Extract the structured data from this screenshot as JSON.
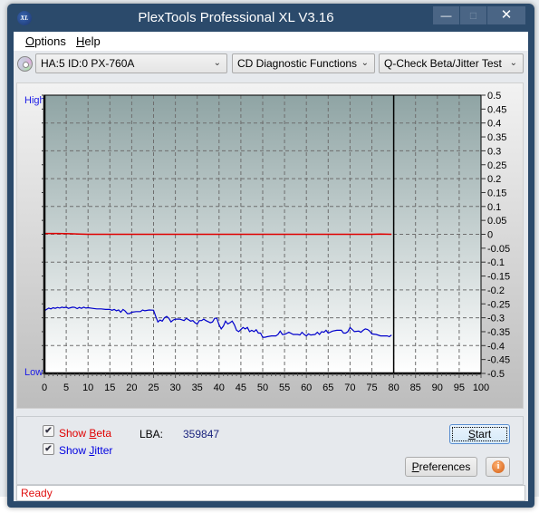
{
  "window": {
    "title": "PlexTools Professional XL V3.16",
    "app_icon": "XL",
    "controls": {
      "minimize": "minimize-icon",
      "maximize": "maximize-icon",
      "close": "close-icon"
    }
  },
  "menu": {
    "items": [
      {
        "label": "Options",
        "accel": "O",
        "rest": "ptions"
      },
      {
        "label": "Help",
        "accel": "H",
        "rest": "elp"
      }
    ]
  },
  "toolbar": {
    "drive_icon": "cd-disc-icon",
    "drive": "HA:5 ID:0  PX-760A",
    "function_group": "CD Diagnostic Functions",
    "test": "Q-Check Beta/Jitter Test"
  },
  "chart_labels": {
    "high": "High",
    "low": "Low"
  },
  "chart_data": {
    "type": "line",
    "title": "",
    "xlabel": "",
    "ylabel": "",
    "xlim": [
      0,
      100
    ],
    "ylim": [
      -0.5,
      0.5
    ],
    "x_ticks": [
      0,
      5,
      10,
      15,
      20,
      25,
      30,
      35,
      40,
      45,
      50,
      55,
      60,
      65,
      70,
      75,
      80,
      85,
      90,
      95,
      100
    ],
    "y_ticks": [
      0.5,
      0.45,
      0.4,
      0.35,
      0.3,
      0.25,
      0.2,
      0.15,
      0.1,
      0.05,
      0,
      -0.05,
      -0.1,
      -0.15,
      -0.2,
      -0.25,
      -0.3,
      -0.35,
      -0.4,
      -0.45,
      -0.5
    ],
    "y_tick_labels": [
      "0.5",
      "0.45",
      "0.4",
      "0.35",
      "0.3",
      "0.25",
      "0.2",
      "0.15",
      "0.1",
      "0.05",
      "0",
      "-0.05",
      "-0.1",
      "-0.15",
      "-0.2",
      "-0.25",
      "-0.3",
      "-0.35",
      "-0.4",
      "-0.45",
      "-0.5"
    ],
    "grid": true,
    "progress_marker_x": 80,
    "series": [
      {
        "name": "Beta",
        "color": "#e00000",
        "x": [
          0,
          3,
          6,
          8,
          10,
          20,
          30,
          40,
          50,
          60,
          70,
          75,
          77,
          79.5
        ],
        "values": [
          0.003,
          0.003,
          0.002,
          0.001,
          0.0,
          0.0,
          0.0,
          0.0,
          0.0,
          0.0,
          0.0,
          0.0,
          0.001,
          0.0
        ]
      },
      {
        "name": "Jitter",
        "color": "#0000cc",
        "x": [
          0,
          0.5,
          1,
          1.5,
          2,
          2.5,
          3,
          3.5,
          4,
          4.5,
          5,
          5.5,
          6,
          6.5,
          7,
          7.5,
          8,
          8.5,
          9,
          9.5,
          10,
          11,
          12,
          13,
          14,
          15,
          15.5,
          16,
          16.5,
          17,
          17.5,
          18,
          18.5,
          19,
          19.5,
          20,
          21,
          22,
          22.5,
          23,
          24,
          25,
          25.5,
          26,
          26.5,
          27,
          27.5,
          28,
          28.5,
          29,
          29.5,
          30,
          31,
          32,
          32.5,
          33,
          33.5,
          34,
          34.5,
          35,
          35.5,
          36,
          36.5,
          37,
          38,
          38.5,
          39,
          39.5,
          40,
          40.5,
          41,
          41.5,
          42,
          42.5,
          43,
          43.5,
          44,
          44.5,
          45,
          45.5,
          46,
          46.5,
          47,
          47.5,
          48,
          48.5,
          49,
          49.5,
          50,
          50.5,
          51,
          52,
          53,
          53.5,
          54,
          54.5,
          55,
          56,
          57,
          58,
          58.5,
          59,
          59.5,
          60,
          60.5,
          61,
          62,
          62.5,
          63,
          63.5,
          64,
          64.5,
          65,
          66,
          67,
          68,
          68.5,
          69,
          69.5,
          70,
          70.5,
          71,
          72,
          72.5,
          73,
          73.5,
          74,
          74.5,
          75,
          76,
          77,
          78,
          78.5,
          79,
          79.5
        ],
        "values": [
          -0.275,
          -0.27,
          -0.265,
          -0.268,
          -0.264,
          -0.266,
          -0.263,
          -0.265,
          -0.262,
          -0.264,
          -0.262,
          -0.266,
          -0.264,
          -0.262,
          -0.263,
          -0.267,
          -0.263,
          -0.266,
          -0.262,
          -0.265,
          -0.264,
          -0.266,
          -0.268,
          -0.268,
          -0.27,
          -0.27,
          -0.273,
          -0.27,
          -0.275,
          -0.272,
          -0.28,
          -0.27,
          -0.276,
          -0.285,
          -0.285,
          -0.28,
          -0.278,
          -0.278,
          -0.272,
          -0.275,
          -0.272,
          -0.273,
          -0.295,
          -0.315,
          -0.308,
          -0.312,
          -0.3,
          -0.295,
          -0.302,
          -0.315,
          -0.308,
          -0.305,
          -0.305,
          -0.31,
          -0.302,
          -0.307,
          -0.312,
          -0.31,
          -0.318,
          -0.322,
          -0.31,
          -0.31,
          -0.305,
          -0.31,
          -0.318,
          -0.315,
          -0.302,
          -0.302,
          -0.325,
          -0.34,
          -0.33,
          -0.312,
          -0.322,
          -0.318,
          -0.312,
          -0.325,
          -0.345,
          -0.35,
          -0.342,
          -0.335,
          -0.34,
          -0.335,
          -0.35,
          -0.345,
          -0.35,
          -0.343,
          -0.355,
          -0.355,
          -0.37,
          -0.37,
          -0.368,
          -0.365,
          -0.365,
          -0.36,
          -0.348,
          -0.36,
          -0.36,
          -0.352,
          -0.36,
          -0.36,
          -0.362,
          -0.352,
          -0.36,
          -0.365,
          -0.358,
          -0.362,
          -0.36,
          -0.352,
          -0.36,
          -0.35,
          -0.352,
          -0.345,
          -0.355,
          -0.348,
          -0.345,
          -0.345,
          -0.355,
          -0.355,
          -0.35,
          -0.335,
          -0.342,
          -0.35,
          -0.348,
          -0.352,
          -0.345,
          -0.34,
          -0.342,
          -0.348,
          -0.358,
          -0.36,
          -0.365,
          -0.365,
          -0.365,
          -0.368,
          -0.362,
          -0.365
        ]
      }
    ]
  },
  "options": {
    "show_beta": {
      "label_pre": "Show ",
      "accel": "B",
      "label_post": "eta",
      "checked": true,
      "color": "#e00000"
    },
    "show_jitter": {
      "label_pre": "Show ",
      "accel": "J",
      "label_post": "itter",
      "checked": true,
      "color": "#0000e0"
    }
  },
  "lba": {
    "label": "LBA:",
    "value": "359847"
  },
  "buttons": {
    "start": {
      "accel": "S",
      "rest": "tart"
    },
    "preferences": {
      "accel": "P",
      "rest": "references"
    },
    "info_icon": "i"
  },
  "status": {
    "text": "Ready"
  }
}
